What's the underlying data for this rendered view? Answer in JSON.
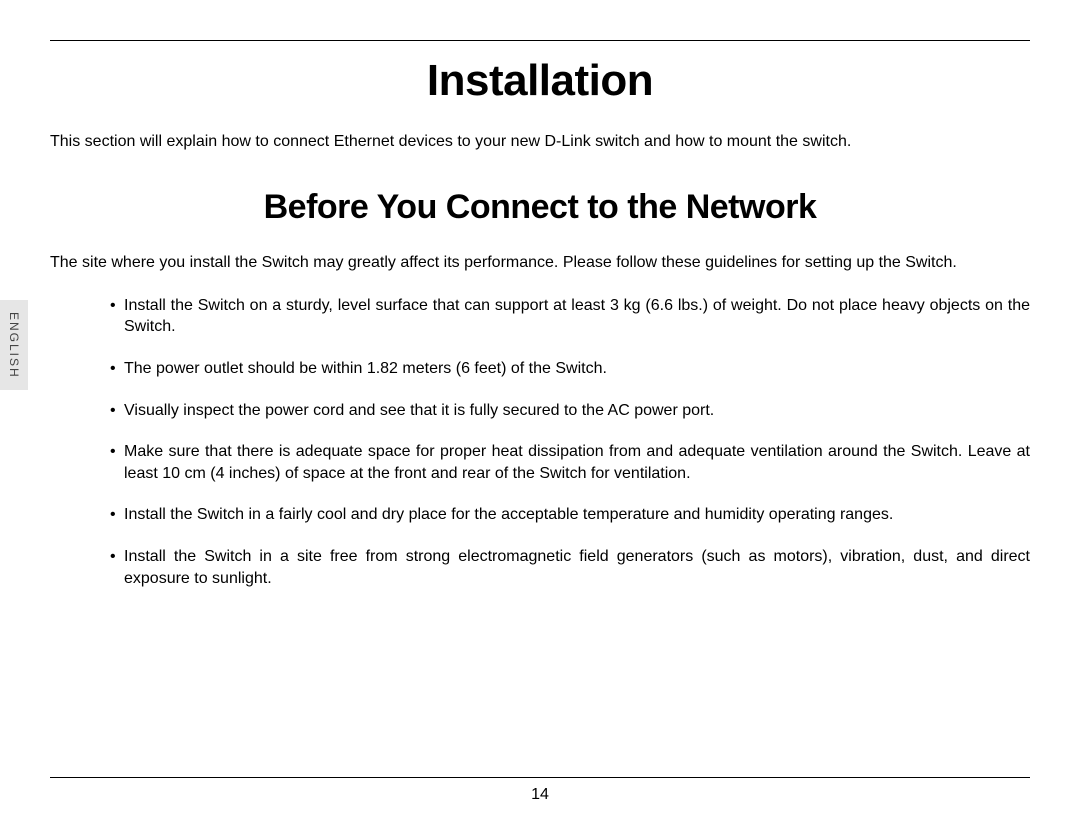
{
  "title": "Installation",
  "intro": "This section will explain how to connect Ethernet devices to your new D-Link switch and how to mount the switch.",
  "subtitle": "Before You Connect to the Network",
  "subintro": "The site where you install the Switch may greatly affect its performance. Please follow these guidelines for setting up the Switch.",
  "bullets": [
    "Install the Switch on a sturdy, level surface that can support at least 3 kg (6.6 lbs.) of weight. Do not place heavy objects on the Switch.",
    "The power outlet should be within 1.82 meters (6 feet) of the Switch.",
    "Visually inspect the power cord and see that it is fully secured to the AC power port.",
    "Make sure that there is adequate space for proper heat dissipation from and adequate ventilation around the Switch. Leave at least 10 cm (4 inches) of space at the front and rear of the Switch for ventilation.",
    "Install the Switch in a fairly cool and dry place for the acceptable temperature and humidity operating ranges.",
    "Install the Switch in a site free from strong electromagnetic field generators (such as motors), vibration, dust, and direct exposure to sunlight."
  ],
  "language_label": "ENGLISH",
  "page_number": "14"
}
